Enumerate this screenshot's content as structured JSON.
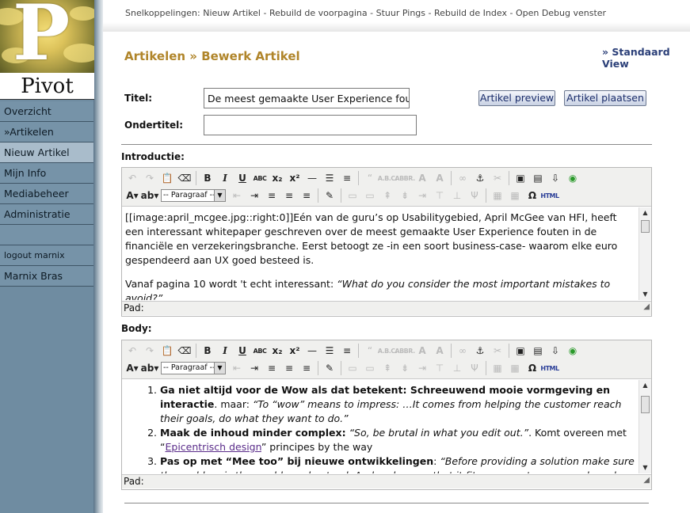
{
  "app": {
    "logo_text": "Pivot"
  },
  "sidebar": {
    "items": [
      {
        "label": "Overzicht",
        "active": false
      },
      {
        "label": "»Artikelen",
        "active": false
      },
      {
        "label": "Nieuw Artikel",
        "active": true
      },
      {
        "label": "Mijn Info",
        "active": false
      },
      {
        "label": "Mediabeheer",
        "active": false
      },
      {
        "label": "Administratie",
        "active": false
      }
    ],
    "logout": "logout marnix",
    "user": "Marnix Bras"
  },
  "quicklinks": {
    "prefix": "Snelkoppelingen:",
    "links": [
      "Nieuw Artikel",
      "Rebuild de voorpagina",
      "Stuur Pings",
      "Rebuild de Index",
      "Open Debug venster"
    ],
    "separator": " - "
  },
  "header": {
    "title": "Artikelen » Bewerk Artikel",
    "standard_view": "» Standaard View"
  },
  "form": {
    "title_label": "Titel:",
    "title_value": "De meest gemaakte User Experience fouten i",
    "subtitle_label": "Ondertitel:",
    "subtitle_value": "",
    "preview_button": "Artikel preview",
    "publish_button": "Artikel plaatsen",
    "intro_label": "Introductie:",
    "body_label": "Body:"
  },
  "editor": {
    "format_select": "-- Paragraaf --",
    "status_label": "Pad:",
    "html_label": "HTML"
  },
  "intro": {
    "p1": "[[image:april_mcgee.jpg::right:0]]Eén van de guru’s op Usabilitygebied, April McGee van HFI, heeft een interessant whitepaper geschreven over de meest gemaakte User Experience fouten in de financiële en verzekeringsbranche. Eerst betoogt ze -in een soort business-case- waarom elke euro gespendeerd aan UX goed besteed is.",
    "p2_plain": "Vanaf pagina 10 wordt 't echt interessant:  ",
    "p2_italic": "“What do you consider the most important mistakes to avoid?”"
  },
  "body": {
    "items": [
      {
        "bold": "Ga niet altijd voor de Wow als dat betekent: Schreeuwend mooie vormgeving en interactie",
        "plain": ". maar: ",
        "italic": "“To “wow” means to impress: …It comes from helping the customer reach their goals, do what they want to do.”",
        "link": "",
        "after": ""
      },
      {
        "bold": "Maak de inhoud minder complex:",
        "plain": " ",
        "italic": "“So, be brutal in what you edit out.”",
        "after": ". Komt overeen met “",
        "link": "Epicentrisch design",
        "after2": "” principes by the way"
      },
      {
        "bold": "Pas op met “Mee too” bij nieuwe ontwikkelingen",
        "plain": ": ",
        "italic": "“Before providing a solution make sure the problem is thoroughly understood. And make sure that it fits your customers needs and goals.”",
        "link": "",
        "after": ""
      }
    ]
  }
}
